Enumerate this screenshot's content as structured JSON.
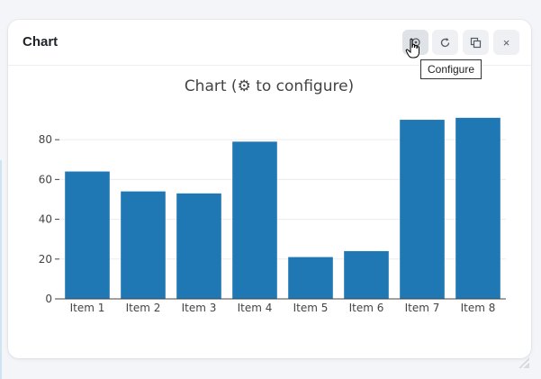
{
  "panel": {
    "title": "Chart"
  },
  "toolbar": {
    "configure_icon": "gear-icon",
    "refresh_icon": "refresh-icon",
    "duplicate_icon": "copy-icon",
    "close_icon": "close-icon",
    "close_glyph": "×",
    "tooltip": "Configure"
  },
  "colors": {
    "bar": "#1f77b4",
    "panel_bg": "#ffffff",
    "page_bg": "#f4f5f8"
  },
  "chart_data": {
    "type": "bar",
    "title": "Chart (⚙ to configure)",
    "xlabel": "",
    "ylabel": "",
    "categories": [
      "Item 1",
      "Item 2",
      "Item 3",
      "Item 4",
      "Item 5",
      "Item 6",
      "Item 7",
      "Item 8"
    ],
    "values": [
      64,
      54,
      53,
      79,
      21,
      24,
      90,
      91
    ],
    "ylim": [
      0,
      95
    ],
    "yticks": [
      0,
      20,
      40,
      60,
      80
    ],
    "grid": true,
    "legend": "none"
  }
}
